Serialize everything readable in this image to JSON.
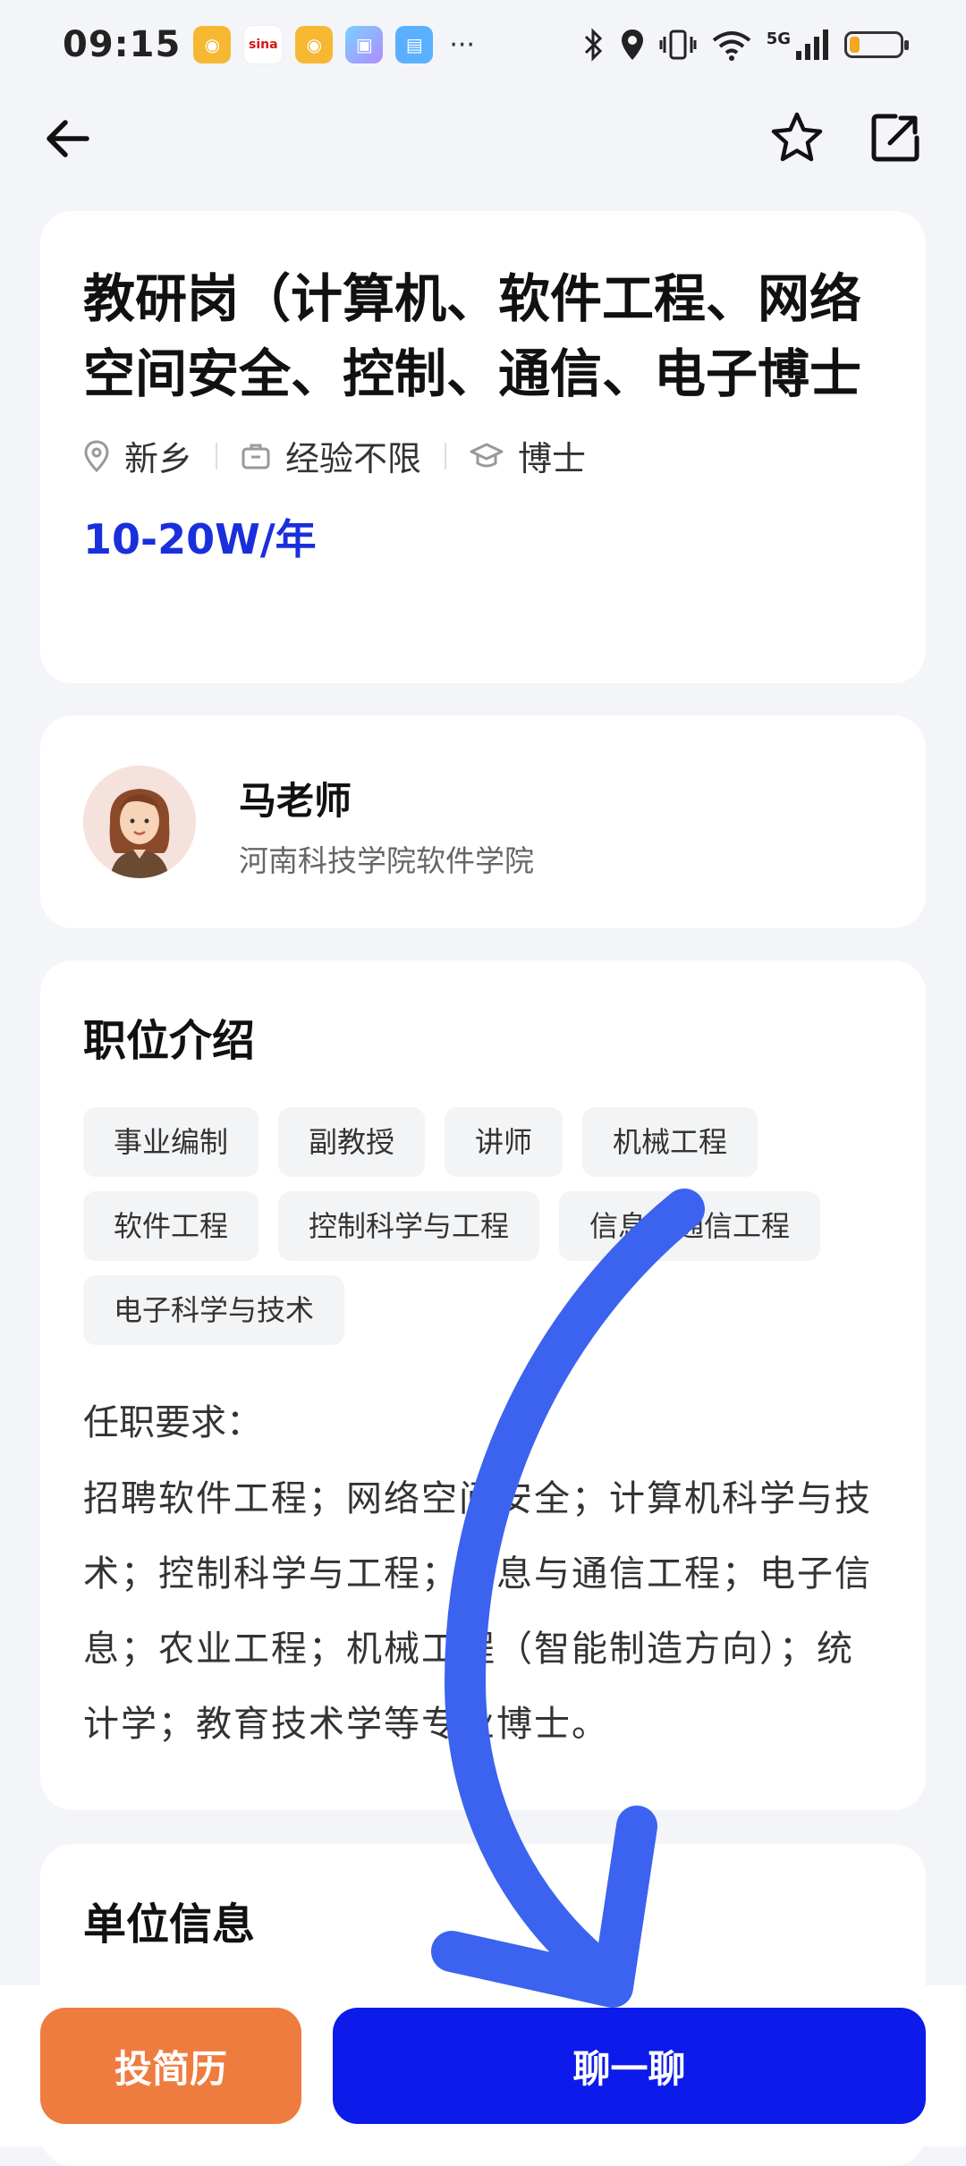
{
  "status_bar": {
    "time": "09:15",
    "app_icons": [
      "weibo-icon",
      "sina-icon",
      "weibo-icon",
      "game-icon",
      "book-icon"
    ],
    "more": "···",
    "network": "5G",
    "battery_level": 0.2
  },
  "header": {
    "back_icon": "arrow-left-icon",
    "favorite_icon": "star-icon",
    "share_icon": "share-icon"
  },
  "job": {
    "title": "教研岗（计算机、软件工程、网络空间安全、控制、通信、电子博士",
    "location": "新乡",
    "experience": "经验不限",
    "education": "博士",
    "salary": "10-20W/年"
  },
  "contact": {
    "name": "马老师",
    "organization": "河南科技学院软件学院"
  },
  "description": {
    "section_title": "职位介绍",
    "tags": [
      "事业编制",
      "副教授",
      "讲师",
      "机械工程",
      "软件工程",
      "控制科学与工程",
      "信息与通信工程",
      "电子科学与技术"
    ],
    "requirements_title": "任职要求：",
    "requirements_body": "招聘软件工程；网络空间安全；计算机科学与技术；控制科学与工程；信息与通信工程；电子信息；农业工程；机械工程（智能制造方向）；统计学；教育技术学等专业博士。"
  },
  "unit": {
    "section_title": "单位信息"
  },
  "actions": {
    "resume_label": "投简历",
    "chat_label": "聊一聊"
  },
  "colors": {
    "accent_blue": "#0c1aea",
    "salary_blue": "#1a2fdc",
    "resume_orange": "#ef7c3f",
    "annotation_arrow": "#3b63f0"
  }
}
